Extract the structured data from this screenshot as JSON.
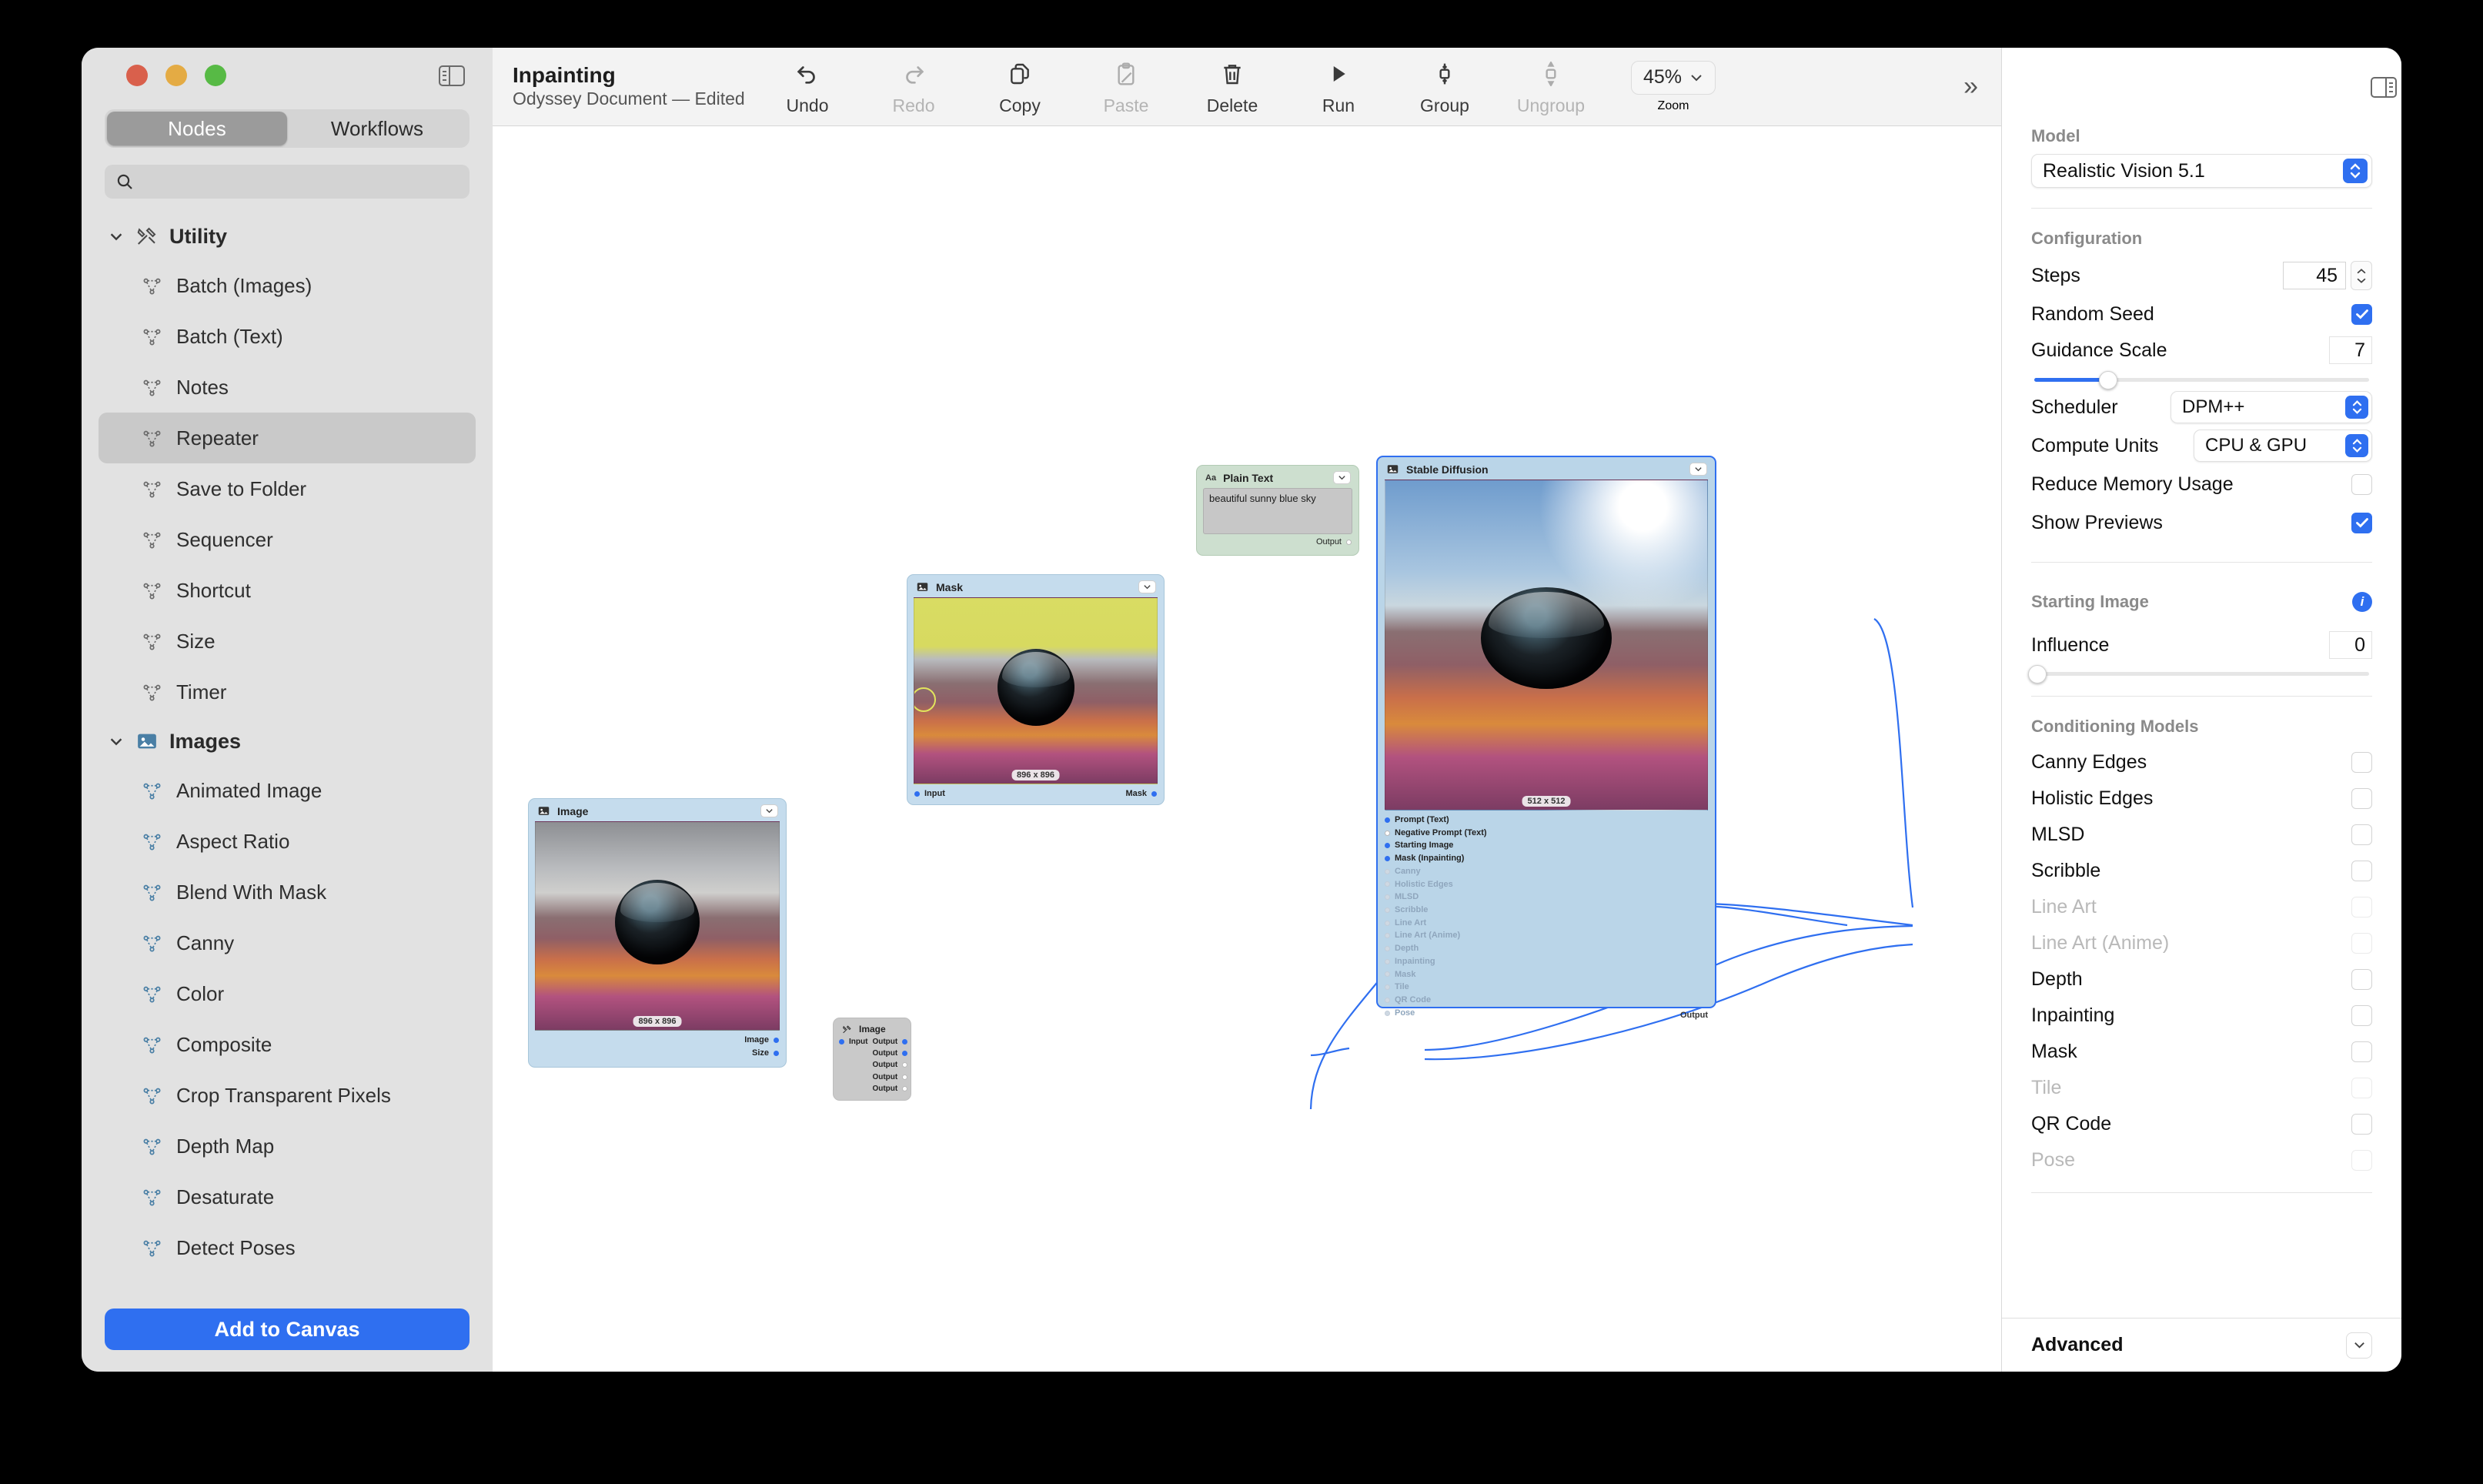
{
  "window": {
    "traffic_lights": [
      "close",
      "minimize",
      "zoom"
    ],
    "sidebar_toggle_icon": "sidebar-left-icon"
  },
  "document": {
    "title": "Inpainting",
    "subtitle": "Odyssey Document — Edited"
  },
  "toolbar": {
    "items": [
      {
        "label": "Undo",
        "icon": "undo-arrow-icon",
        "disabled": false
      },
      {
        "label": "Redo",
        "icon": "redo-arrow-icon",
        "disabled": true
      },
      {
        "label": "Copy",
        "icon": "copy-docs-icon",
        "disabled": false
      },
      {
        "label": "Paste",
        "icon": "paste-clipboard-icon",
        "disabled": true
      },
      {
        "label": "Delete",
        "icon": "trash-icon",
        "disabled": false
      },
      {
        "label": "Run",
        "icon": "play-triangle-icon",
        "disabled": false
      },
      {
        "label": "Group",
        "icon": "group-icon",
        "disabled": false
      },
      {
        "label": "Ungroup",
        "icon": "ungroup-icon",
        "disabled": true
      }
    ],
    "zoom": {
      "value": "45%",
      "label": "Zoom",
      "chevron_icon": "chevron-down-icon"
    },
    "expander_icon": "chevrons-right-icon"
  },
  "sidebar": {
    "tabs": [
      {
        "label": "Nodes",
        "active": true
      },
      {
        "label": "Workflows",
        "active": false
      }
    ],
    "search": {
      "value": "",
      "placeholder": "",
      "icon": "search-icon"
    },
    "groups": [
      {
        "label": "Utility",
        "icon": "tools-icon",
        "expanded": true,
        "items": [
          {
            "label": "Batch (Images)",
            "selected": false
          },
          {
            "label": "Batch (Text)",
            "selected": false
          },
          {
            "label": "Notes",
            "selected": false
          },
          {
            "label": "Repeater",
            "selected": true
          },
          {
            "label": "Save to Folder",
            "selected": false
          },
          {
            "label": "Sequencer",
            "selected": false
          },
          {
            "label": "Shortcut",
            "selected": false
          },
          {
            "label": "Size",
            "selected": false
          },
          {
            "label": "Timer",
            "selected": false
          }
        ]
      },
      {
        "label": "Images",
        "icon": "picture-icon",
        "expanded": true,
        "items": [
          {
            "label": "Animated Image",
            "selected": false
          },
          {
            "label": "Aspect Ratio",
            "selected": false
          },
          {
            "label": "Blend With Mask",
            "selected": false
          },
          {
            "label": "Canny",
            "selected": false
          },
          {
            "label": "Color",
            "selected": false
          },
          {
            "label": "Composite",
            "selected": false
          },
          {
            "label": "Crop Transparent Pixels",
            "selected": false
          },
          {
            "label": "Depth Map",
            "selected": false
          },
          {
            "label": "Desaturate",
            "selected": false
          },
          {
            "label": "Detect Poses",
            "selected": false
          }
        ]
      }
    ],
    "add_button": "Add to Canvas"
  },
  "canvas": {
    "nodes": [
      {
        "id": "image-source",
        "title": "Image",
        "icon": "picture-icon",
        "dimension_badge": "896 x 896",
        "outputs": [
          {
            "label": "Image",
            "connected": true
          },
          {
            "label": "Size",
            "connected": true
          }
        ]
      },
      {
        "id": "repeater",
        "title": "Image",
        "icon": "tools-icon",
        "inputs": [
          {
            "label": "Input",
            "connected": true
          }
        ],
        "outputs": [
          {
            "label": "Output",
            "connected": true
          },
          {
            "label": "Output",
            "connected": true
          },
          {
            "label": "Output",
            "connected": false
          },
          {
            "label": "Output",
            "connected": false
          },
          {
            "label": "Output",
            "connected": false
          }
        ]
      },
      {
        "id": "mask",
        "title": "Mask",
        "icon": "picture-icon",
        "dimension_badge": "896 x 896",
        "inputs": [
          {
            "label": "Input",
            "connected": true
          }
        ],
        "outputs": [
          {
            "label": "Mask",
            "connected": true
          }
        ]
      },
      {
        "id": "plain-text",
        "title": "Plain Text",
        "icon": "aa-text-icon",
        "text_value": "beautiful sunny blue sky",
        "outputs": [
          {
            "label": "Output",
            "connected": false
          }
        ]
      },
      {
        "id": "stable-diffusion",
        "title": "Stable Diffusion",
        "icon": "picture-icon",
        "selected": true,
        "dimension_badge": "512 x 512",
        "inputs": [
          {
            "label": "Prompt (Text)",
            "connected": true,
            "dim": false
          },
          {
            "label": "Negative Prompt (Text)",
            "connected": false,
            "dim": false
          },
          {
            "label": "Starting Image",
            "connected": true,
            "dim": false
          },
          {
            "label": "Mask (Inpainting)",
            "connected": true,
            "dim": false
          },
          {
            "label": "Canny",
            "connected": false,
            "dim": true
          },
          {
            "label": "Holistic Edges",
            "connected": false,
            "dim": true
          },
          {
            "label": "MLSD",
            "connected": false,
            "dim": true
          },
          {
            "label": "Scribble",
            "connected": false,
            "dim": true
          },
          {
            "label": "Line Art",
            "connected": false,
            "dim": true
          },
          {
            "label": "Line Art (Anime)",
            "connected": false,
            "dim": true
          },
          {
            "label": "Depth",
            "connected": false,
            "dim": true
          },
          {
            "label": "Inpainting",
            "connected": false,
            "dim": true
          },
          {
            "label": "Mask",
            "connected": false,
            "dim": true
          },
          {
            "label": "Tile",
            "connected": false,
            "dim": true
          },
          {
            "label": "QR Code",
            "connected": false,
            "dim": true
          },
          {
            "label": "Pose",
            "connected": false,
            "dim": true
          }
        ],
        "output_label": "Output"
      }
    ]
  },
  "inspector": {
    "panel_toggle_icon": "sidebar-right-icon",
    "model": {
      "label": "Model",
      "value": "Realistic Vision 5.1"
    },
    "configuration": {
      "label": "Configuration",
      "steps": {
        "label": "Steps",
        "value": "45"
      },
      "random_seed": {
        "label": "Random Seed",
        "checked": true
      },
      "guidance_scale": {
        "label": "Guidance Scale",
        "value": "7",
        "slider_percent": 22
      },
      "scheduler": {
        "label": "Scheduler",
        "value": "DPM++"
      },
      "compute_units": {
        "label": "Compute Units",
        "value": "CPU & GPU"
      },
      "reduce_memory": {
        "label": "Reduce Memory Usage",
        "checked": false
      },
      "show_previews": {
        "label": "Show Previews",
        "checked": true
      }
    },
    "starting_image": {
      "label": "Starting Image",
      "info_icon": "info-icon",
      "influence": {
        "label": "Influence",
        "value": "0",
        "slider_percent": 0
      }
    },
    "conditioning_models": {
      "label": "Conditioning Models",
      "items": [
        {
          "label": "Canny Edges",
          "checked": false,
          "disabled": false
        },
        {
          "label": "Holistic Edges",
          "checked": false,
          "disabled": false
        },
        {
          "label": "MLSD",
          "checked": false,
          "disabled": false
        },
        {
          "label": "Scribble",
          "checked": false,
          "disabled": false
        },
        {
          "label": "Line Art",
          "checked": false,
          "disabled": true
        },
        {
          "label": "Line Art (Anime)",
          "checked": false,
          "disabled": true
        },
        {
          "label": "Depth",
          "checked": false,
          "disabled": false
        },
        {
          "label": "Inpainting",
          "checked": false,
          "disabled": false
        },
        {
          "label": "Mask",
          "checked": false,
          "disabled": false
        },
        {
          "label": "Tile",
          "checked": false,
          "disabled": true
        },
        {
          "label": "QR Code",
          "checked": false,
          "disabled": false
        },
        {
          "label": "Pose",
          "checked": false,
          "disabled": true
        }
      ]
    },
    "advanced": {
      "label": "Advanced",
      "chevron_icon": "chevron-down-icon"
    }
  },
  "colors": {
    "accent": "#2f6ff0",
    "node_image": "#c5dced",
    "node_text": "#cddfcf",
    "selected_border": "#2f6ff0"
  }
}
